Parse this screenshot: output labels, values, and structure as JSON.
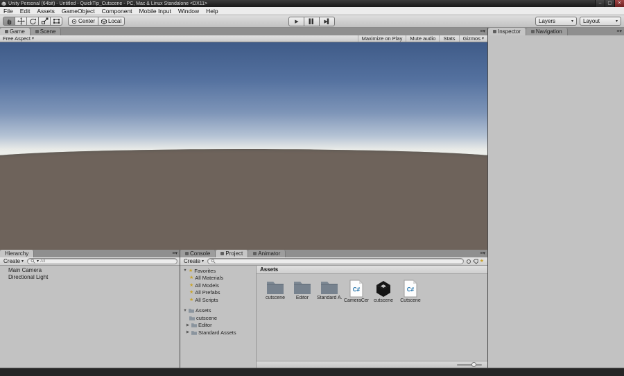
{
  "window": {
    "title": "Unity Personal (64bit) - Untitled - QuickTip_Cutscene - PC, Mac & Linux Standalone <DX11>",
    "minimize": "–",
    "maximize": "▢",
    "close": "✕"
  },
  "menubar": {
    "items": [
      "File",
      "Edit",
      "Assets",
      "GameObject",
      "Component",
      "Mobile Input",
      "Window",
      "Help"
    ]
  },
  "toolbar": {
    "pivot": "Center",
    "space": "Local",
    "play": "▶",
    "pause": "▌▌",
    "step": "▶▌",
    "layers": "Layers",
    "layout": "Layout"
  },
  "game": {
    "tab_game": "Game",
    "tab_scene": "Scene",
    "aspect": "Free Aspect",
    "maximize_on_play": "Maximize on Play",
    "mute_audio": "Mute audio",
    "stats": "Stats",
    "gizmos": "Gizmos"
  },
  "inspector": {
    "tab_inspector": "Inspector",
    "tab_navigation": "Navigation"
  },
  "hierarchy": {
    "tab": "Hierarchy",
    "create": "Create",
    "search_hint": "All",
    "items": [
      "Main Camera",
      "Directional Light"
    ]
  },
  "bottom": {
    "tab_console": "Console",
    "tab_project": "Project",
    "tab_animator": "Animator"
  },
  "project": {
    "create": "Create",
    "search_hint": "",
    "favorites_label": "Favorites",
    "favorites": [
      "All Materials",
      "All Models",
      "All Prefabs",
      "All Scripts"
    ],
    "assets_label": "Assets",
    "tree_items": [
      "cutscene",
      "Editor",
      "Standard Assets"
    ],
    "header": "Assets",
    "items": [
      {
        "name": "cutscene",
        "type": "folder"
      },
      {
        "name": "Editor",
        "type": "folder"
      },
      {
        "name": "Standard A...",
        "type": "folder"
      },
      {
        "name": "CameraCen...",
        "type": "csharp"
      },
      {
        "name": "cutscene",
        "type": "unity"
      },
      {
        "name": "Cutscene",
        "type": "csharp"
      }
    ]
  },
  "colors": {
    "sky_top": "#3f5b88",
    "sky_horizon": "#e8eae7",
    "ground": "#6e635b",
    "folder": "#6d7884",
    "csharp_blue": "#1b6ea8"
  }
}
